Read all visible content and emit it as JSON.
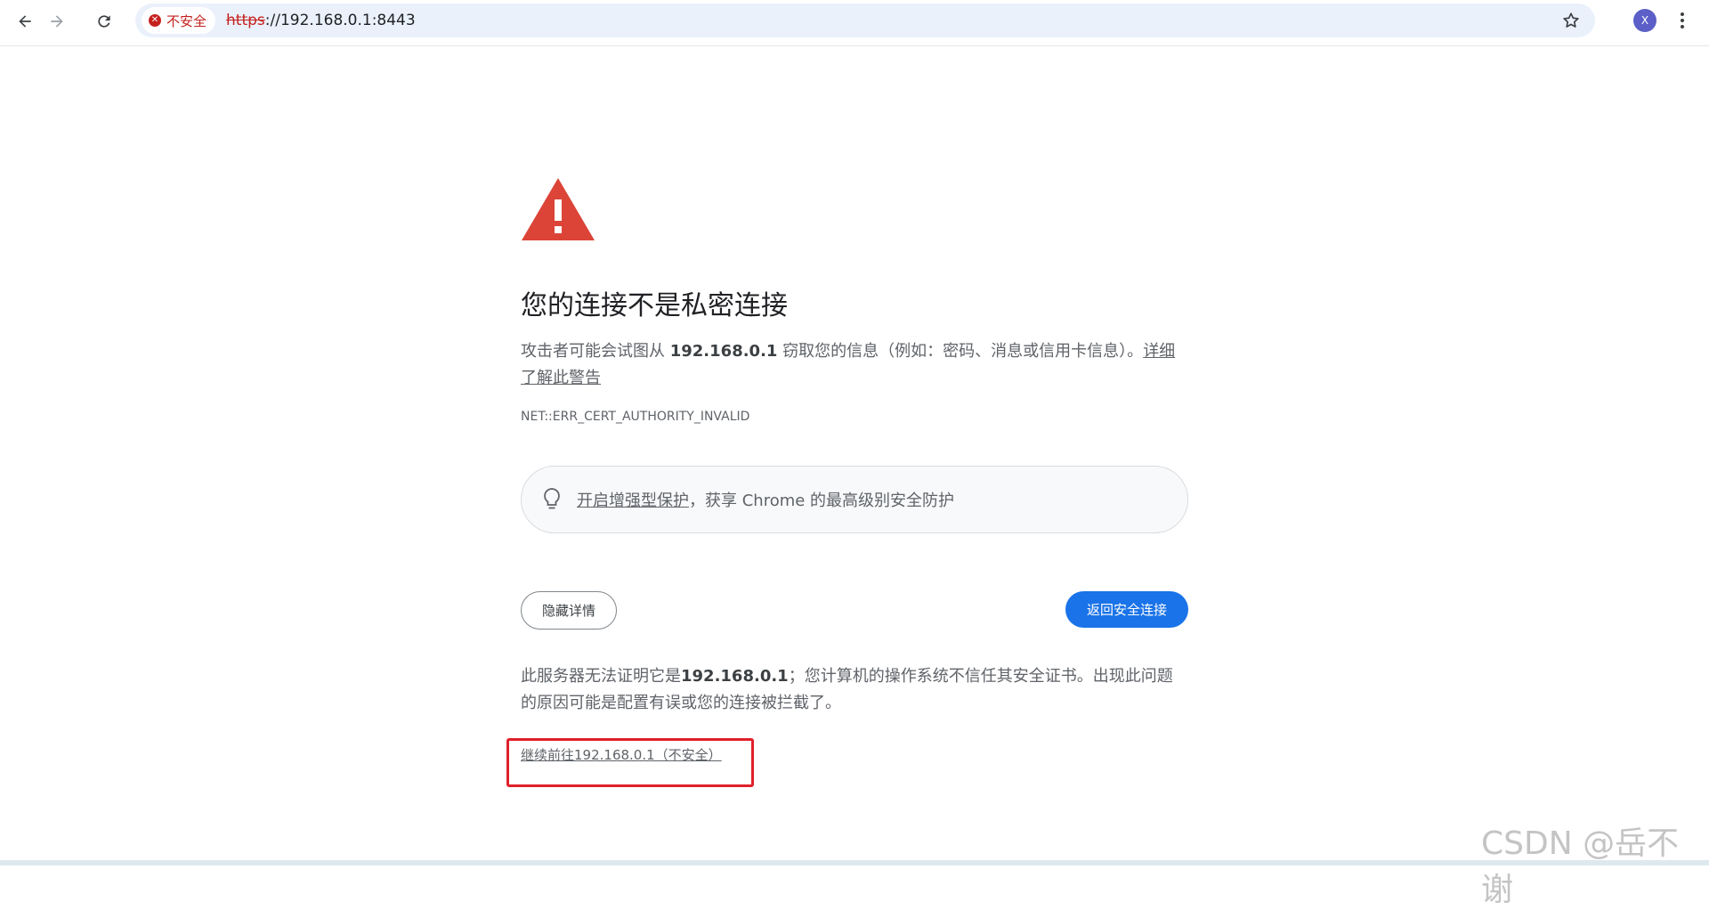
{
  "browser": {
    "security_label": "不安全",
    "url_scheme": "https",
    "url_rest": "://192.168.0.1:8443",
    "profile_initial": "X",
    "icons": [
      "back-arrow-icon",
      "forward-arrow-icon",
      "reload-icon",
      "error-icon",
      "star-icon",
      "more-vert-icon"
    ]
  },
  "page": {
    "heading": "您的连接不是私密连接",
    "desc_prefix": "攻击者可能会试图从 ",
    "desc_host": "192.168.0.1",
    "desc_suffix": " 窃取您的信息（例如：密码、消息或信用卡信息）。",
    "learn_more": "详细了解此警告",
    "error_code": "NET::ERR_CERT_AUTHORITY_INVALID",
    "enhanced_link": "开启增强型保护",
    "enhanced_text": "，获享 Chrome 的最高级别安全防护",
    "hide_details_button": "隐藏详情",
    "back_to_safety_button": "返回安全连接",
    "explain_prefix": "此服务器无法证明它是",
    "explain_host": "192.168.0.1",
    "explain_suffix": "；您计算机的操作系统不信任其安全证书。出现此问题的原因可能是配置有误或您的连接被拦截了。",
    "proceed_link": "继续前往192.168.0.1（不安全）"
  },
  "watermark": "CSDN @岳不谢",
  "colors": {
    "warning_red": "#db4437",
    "primary_blue": "#1a73e8",
    "annotation_red": "#e0202a"
  }
}
